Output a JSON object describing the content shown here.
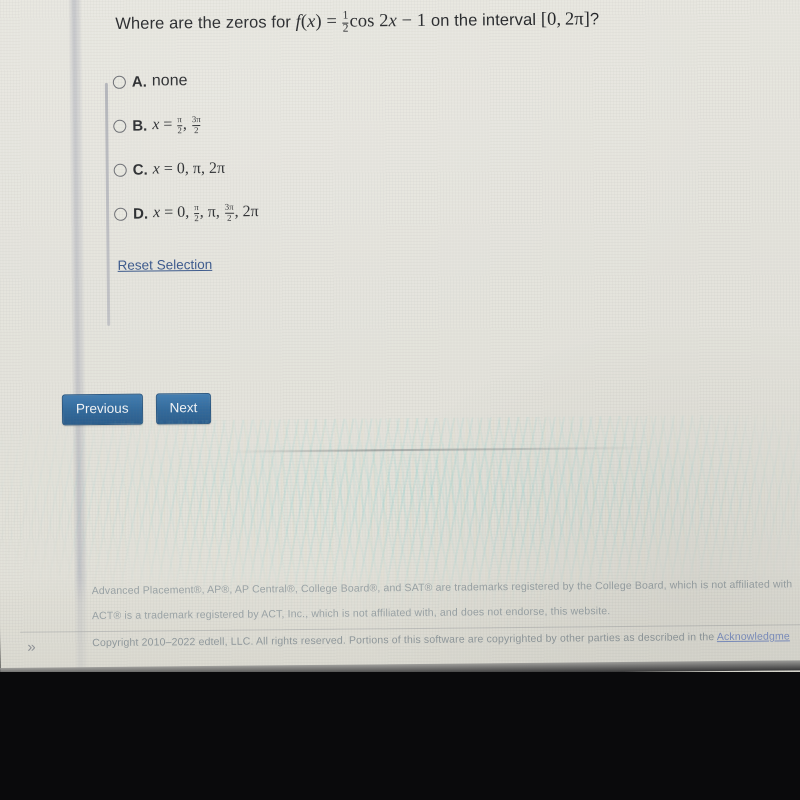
{
  "quiz": {
    "question": {
      "prefix": "Where are the zeros for",
      "function": "f(x) = ½cos 2x − 1",
      "middle": "on the interval",
      "interval": "[0, 2π]",
      "suffix": "?",
      "full_text": "Where are the zeros for f(x) = 1/2 cos 2x - 1 on the interval [0, 2π]?"
    },
    "options": [
      {
        "id": "A",
        "label": "A.",
        "text": "none",
        "selected": false
      },
      {
        "id": "B",
        "label": "B.",
        "text": "x = π/2, 3π/2",
        "selected": false
      },
      {
        "id": "C",
        "label": "C.",
        "text": "x = 0, π, 2π",
        "selected": false
      },
      {
        "id": "D",
        "label": "D.",
        "text": "x = 0, π/2, π, 3π/2, 2π",
        "selected": false
      }
    ],
    "reset_link": "Reset Selection",
    "buttons": {
      "previous": "Previous",
      "next": "Next"
    }
  },
  "footer": {
    "line1": "Advanced Placement®, AP®, AP Central®, College Board®, and SAT® are trademarks registered by the College Board, which is not affiliated with",
    "line2": "ACT® is a trademark registered by ACT, Inc., which is not affiliated with, and does not endorse, this website.",
    "line3_before": "Copyright 2010–2022 edtell, LLC. All rights reserved. Portions of this software are copyrighted by other parties as described in the ",
    "line3_link": "Acknowledgme",
    "expander_icon": "»"
  },
  "colors": {
    "page_background": "#e4e3dc",
    "button_blue": "#2d6699",
    "link_blue": "#2f4f86",
    "text": "#1e2023",
    "footer_text": "#9aa3a6",
    "bezel_dark": "#0a0a0c"
  }
}
